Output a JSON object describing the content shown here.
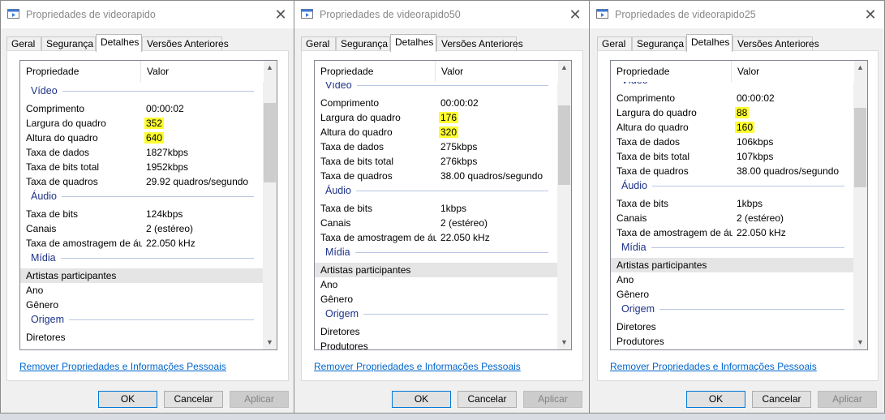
{
  "dialogs": [
    {
      "title": "Propriedades de videorapido",
      "tabs": [
        "Geral",
        "Segurança",
        "Detalhes",
        "Versões Anteriores"
      ],
      "active_tab": "Detalhes",
      "columns": {
        "property": "Propriedade",
        "value": "Valor"
      },
      "link": "Remover Propriedades e Informações Pessoais",
      "buttons": {
        "ok": "OK",
        "cancel": "Cancelar",
        "apply": "Aplicar"
      },
      "close": "✕",
      "scroll_up": "▲",
      "scroll_down": "▼",
      "rows": [
        {
          "kind": "group",
          "label": "Vídeo"
        },
        {
          "label": "Comprimento",
          "value": "00:00:02"
        },
        {
          "label": "Largura do quadro",
          "value": "352",
          "highlight": true
        },
        {
          "label": "Altura do quadro",
          "value": "640",
          "highlight": true
        },
        {
          "label": "Taxa de dados",
          "value": "1827kbps"
        },
        {
          "label": "Taxa de bits total",
          "value": "1952kbps"
        },
        {
          "label": "Taxa de quadros",
          "value": "29.92 quadros/segundo"
        },
        {
          "kind": "group",
          "label": "Áudio"
        },
        {
          "label": "Taxa de bits",
          "value": "124kbps"
        },
        {
          "label": "Canais",
          "value": "2 (estéreo)"
        },
        {
          "label": "Taxa de amostragem de áudio",
          "value": "22.050 kHz"
        },
        {
          "kind": "group",
          "label": "Mídia"
        },
        {
          "label": "Artistas participantes",
          "value": "",
          "selected": true
        },
        {
          "label": "Ano",
          "value": ""
        },
        {
          "label": "Gênero",
          "value": ""
        },
        {
          "kind": "group",
          "label": "Origem"
        },
        {
          "label": "Diretores",
          "value": ""
        }
      ]
    },
    {
      "title": "Propriedades de videorapido50",
      "tabs": [
        "Geral",
        "Segurança",
        "Detalhes",
        "Versões Anteriores"
      ],
      "active_tab": "Detalhes",
      "columns": {
        "property": "Propriedade",
        "value": "Valor"
      },
      "link": "Remover Propriedades e Informações Pessoais",
      "buttons": {
        "ok": "OK",
        "cancel": "Cancelar",
        "apply": "Aplicar"
      },
      "close": "✕",
      "scroll_up": "▲",
      "scroll_down": "▼",
      "rows": [
        {
          "kind": "group",
          "label": "Vídeo"
        },
        {
          "label": "Comprimento",
          "value": "00:00:02"
        },
        {
          "label": "Largura do quadro",
          "value": "176",
          "highlight": true
        },
        {
          "label": "Altura do quadro",
          "value": "320",
          "highlight": true
        },
        {
          "label": "Taxa de dados",
          "value": "275kbps"
        },
        {
          "label": "Taxa de bits total",
          "value": "276kbps"
        },
        {
          "label": "Taxa de quadros",
          "value": "38.00 quadros/segundo"
        },
        {
          "kind": "group",
          "label": "Áudio"
        },
        {
          "label": "Taxa de bits",
          "value": "1kbps"
        },
        {
          "label": "Canais",
          "value": "2 (estéreo)"
        },
        {
          "label": "Taxa de amostragem de áudio",
          "value": "22.050 kHz"
        },
        {
          "kind": "group",
          "label": "Mídia"
        },
        {
          "label": "Artistas participantes",
          "value": "",
          "selected": true
        },
        {
          "label": "Ano",
          "value": ""
        },
        {
          "label": "Gênero",
          "value": ""
        },
        {
          "kind": "group",
          "label": "Origem"
        },
        {
          "label": "Diretores",
          "value": ""
        },
        {
          "label": "Produtores",
          "value": ""
        }
      ]
    },
    {
      "title": "Propriedades de videorapido25",
      "tabs": [
        "Geral",
        "Segurança",
        "Detalhes",
        "Versões Anteriores"
      ],
      "active_tab": "Detalhes",
      "columns": {
        "property": "Propriedade",
        "value": "Valor"
      },
      "link": "Remover Propriedades e Informações Pessoais",
      "buttons": {
        "ok": "OK",
        "cancel": "Cancelar",
        "apply": "Aplicar"
      },
      "close": "✕",
      "scroll_up": "▲",
      "scroll_down": "▼",
      "rows": [
        {
          "kind": "group",
          "label": "Vídeo"
        },
        {
          "label": "Comprimento",
          "value": "00:00:02"
        },
        {
          "label": "Largura do quadro",
          "value": "88",
          "highlight": true
        },
        {
          "label": "Altura do quadro",
          "value": "160",
          "highlight": true
        },
        {
          "label": "Taxa de dados",
          "value": "106kbps"
        },
        {
          "label": "Taxa de bits total",
          "value": "107kbps"
        },
        {
          "label": "Taxa de quadros",
          "value": "38.00 quadros/segundo"
        },
        {
          "kind": "group",
          "label": "Áudio"
        },
        {
          "label": "Taxa de bits",
          "value": "1kbps"
        },
        {
          "label": "Canais",
          "value": "2 (estéreo)"
        },
        {
          "label": "Taxa de amostragem de áudio",
          "value": "22.050 kHz"
        },
        {
          "kind": "group",
          "label": "Mídia"
        },
        {
          "label": "Artistas participantes",
          "value": "",
          "selected": true
        },
        {
          "label": "Ano",
          "value": ""
        },
        {
          "label": "Gênero",
          "value": ""
        },
        {
          "kind": "group",
          "label": "Origem"
        },
        {
          "label": "Diretores",
          "value": ""
        },
        {
          "label": "Produtores",
          "value": ""
        }
      ]
    }
  ],
  "colors": {
    "highlight": "#ffff2e",
    "group_text": "#1e3287",
    "link": "#0066cc",
    "primary_border": "#0078d7"
  }
}
